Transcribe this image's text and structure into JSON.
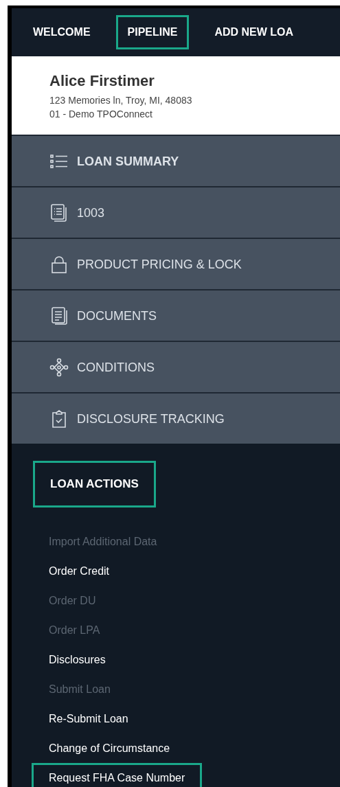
{
  "nav": [
    {
      "label": "WELCOME",
      "highlighted": false
    },
    {
      "label": "PIPELINE",
      "highlighted": true
    },
    {
      "label": "ADD NEW LOA",
      "highlighted": false
    }
  ],
  "borrower": {
    "name": "Alice Firstimer",
    "address": "123 Memories ln, Troy, MI, 48083",
    "company": "01 - Demo TPOConnect"
  },
  "menu": [
    {
      "label": "LOAN SUMMARY",
      "kind": "list",
      "selected": true
    },
    {
      "label": "1003",
      "kind": "form",
      "selected": false
    },
    {
      "label": "PRODUCT PRICING & LOCK",
      "kind": "lock",
      "selected": false
    },
    {
      "label": "DOCUMENTS",
      "kind": "documents",
      "selected": false
    },
    {
      "label": "CONDITIONS",
      "kind": "network",
      "selected": false
    },
    {
      "label": "DISCLOSURE TRACKING",
      "kind": "clipboard",
      "selected": false
    }
  ],
  "loan_actions": {
    "title": "LOAN ACTIONS",
    "highlighted": true,
    "items": [
      {
        "label": "Import Additional Data",
        "disabled": true,
        "highlighted": false
      },
      {
        "label": "Order Credit",
        "disabled": false,
        "highlighted": false
      },
      {
        "label": "Order DU",
        "disabled": true,
        "highlighted": false
      },
      {
        "label": "Order LPA",
        "disabled": true,
        "highlighted": false
      },
      {
        "label": "Disclosures",
        "disabled": false,
        "highlighted": false
      },
      {
        "label": "Submit Loan",
        "disabled": true,
        "highlighted": false
      },
      {
        "label": "Re-Submit Loan",
        "disabled": false,
        "highlighted": false
      },
      {
        "label": "Change of Circumstance",
        "disabled": false,
        "highlighted": false
      },
      {
        "label": "Request FHA Case Number",
        "disabled": false,
        "highlighted": true
      }
    ]
  }
}
